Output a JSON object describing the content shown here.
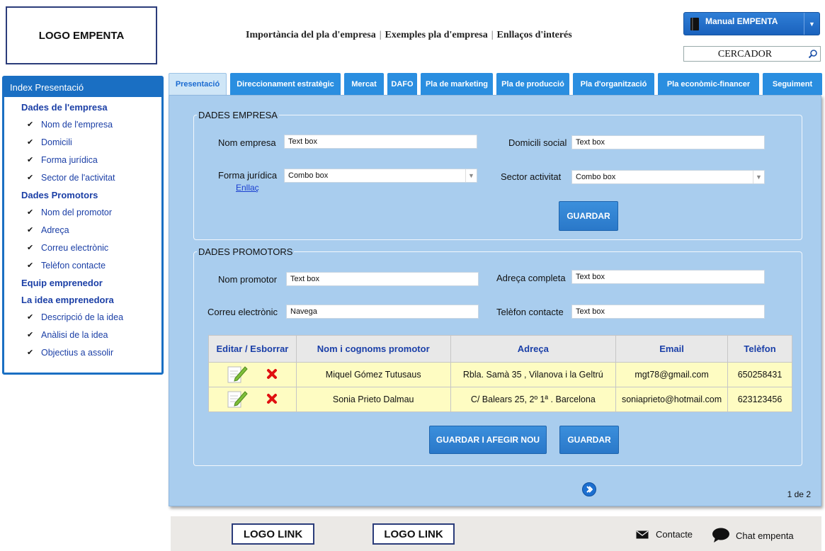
{
  "header": {
    "logo": "LOGO EMPENTA",
    "nav": [
      "Importància del pla d'empresa",
      "Exemples pla d'empresa",
      "Enllaços d'interés"
    ],
    "manual_button": "Manual EMPENTA",
    "search_placeholder": "CERCADOR"
  },
  "sidebar": {
    "title": "Index Presentació",
    "sections": [
      {
        "label": "Dades de l'empresa",
        "items": [
          "Nom de l'empresa",
          "Domicili",
          "Forma jurídica",
          "Sector de l'activitat"
        ]
      },
      {
        "label": "Dades Promotors",
        "items": [
          "Nom del promotor",
          "Adreça",
          "Correu electrònic",
          "Telèfon contacte"
        ]
      },
      {
        "label": "Equip emprenedor",
        "items": []
      },
      {
        "label": "La idea emprenedora",
        "items": [
          "Descripció de la idea",
          "Anàlisi de la idea",
          "Objectius a assolir"
        ]
      }
    ]
  },
  "tabs": [
    "Presentació",
    "Direccionament estratègic",
    "Mercat",
    "DAFO",
    "Pla de marketing",
    "Pla de producció",
    "Pla d'organització",
    "Pla econòmic-financer",
    "Seguiment"
  ],
  "empresa": {
    "legend": "DADES EMPRESA",
    "nom_label": "Nom empresa",
    "nom_value": "Text box",
    "domicili_label": "Domicili social",
    "domicili_value": "Text box",
    "forma_label": "Forma jurídica",
    "forma_value": "Combo box",
    "forma_link": "Enllaç",
    "sector_label": "Sector activitat",
    "sector_value": "Combo box",
    "save": "GUARDAR"
  },
  "promotors": {
    "legend": "DADES PROMOTORS",
    "nom_label": "Nom promotor",
    "nom_value": "Text box",
    "adreca_label": "Adreça completa",
    "adreca_value": "Text box",
    "correu_label": "Correu electrònic",
    "correu_value": "Navega",
    "telefon_label": "Telèfon contacte",
    "telefon_value": "Text box",
    "table": {
      "headers": [
        "Editar / Esborrar",
        "Nom i cognoms promotor",
        "Adreça",
        "Email",
        "Telèfon"
      ],
      "rows": [
        [
          "Miquel Gómez Tutusaus",
          "Rbla. Samà 35 , Vilanova i la Geltrú",
          "mgt78@gmail.com",
          "650258431"
        ],
        [
          "Sonia Prieto Dalmau",
          "C/ Balears 25, 2º 1ª . Barcelona",
          "soniaprieto@hotmail.com",
          "623123456"
        ]
      ]
    },
    "save_add": "GUARDAR I AFEGIR NOU",
    "save": "GUARDAR"
  },
  "pager": "1 de 2",
  "footer": {
    "logo_link_1": "LOGO LINK",
    "logo_link_2": "LOGO LINK",
    "contact": "Contacte",
    "chat": "Chat empenta"
  },
  "colors": {
    "accent": "#1a6fc3",
    "tab": "#2a8ee0",
    "panel": "#a9cdee",
    "row": "#fefcc2"
  }
}
